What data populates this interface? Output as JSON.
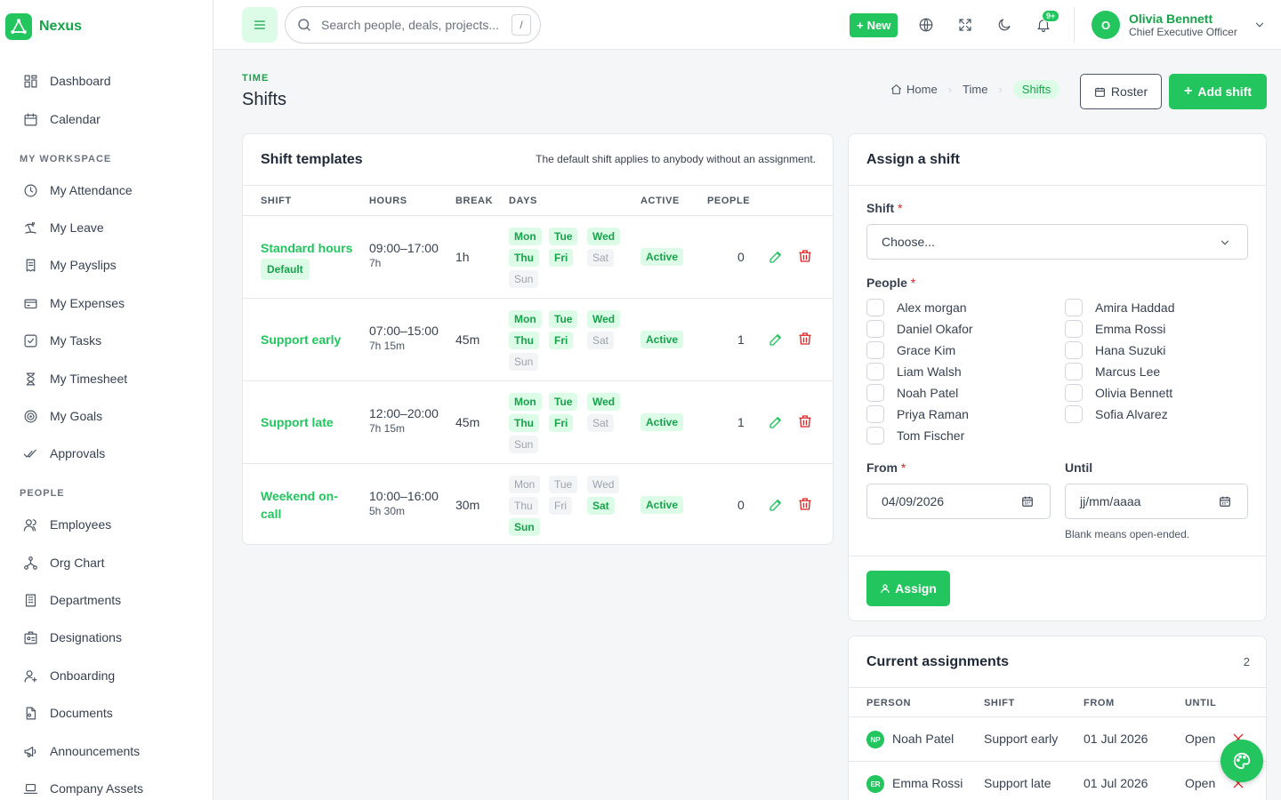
{
  "app": {
    "name": "Nexus"
  },
  "sidebar": {
    "top_items": [
      {
        "label": "Dashboard",
        "icon": "dashboard-icon"
      },
      {
        "label": "Calendar",
        "icon": "calendar-icon"
      }
    ],
    "workspace_title": "MY WORKSPACE",
    "workspace_items": [
      {
        "label": "My Attendance",
        "icon": "clock-icon"
      },
      {
        "label": "My Leave",
        "icon": "beach-icon"
      },
      {
        "label": "My Payslips",
        "icon": "receipt-icon"
      },
      {
        "label": "My Expenses",
        "icon": "credit-card-icon"
      },
      {
        "label": "My Tasks",
        "icon": "checkbox-icon"
      },
      {
        "label": "My Timesheet",
        "icon": "hourglass-icon"
      },
      {
        "label": "My Goals",
        "icon": "target-icon"
      },
      {
        "label": "Approvals",
        "icon": "double-check-icon"
      }
    ],
    "people_title": "PEOPLE",
    "people_items": [
      {
        "label": "Employees",
        "icon": "users-icon"
      },
      {
        "label": "Org Chart",
        "icon": "org-chart-icon"
      },
      {
        "label": "Departments",
        "icon": "building-icon"
      },
      {
        "label": "Designations",
        "icon": "id-card-icon"
      },
      {
        "label": "Onboarding",
        "icon": "user-plus-icon"
      },
      {
        "label": "Documents",
        "icon": "document-icon"
      },
      {
        "label": "Announcements",
        "icon": "megaphone-icon"
      },
      {
        "label": "Company Assets",
        "icon": "laptop-icon"
      }
    ]
  },
  "topbar": {
    "search_placeholder": "Search people, deals, projects...",
    "search_shortcut": "/",
    "new_label": "New",
    "notifications_badge": "9+",
    "user": {
      "initial": "O",
      "name": "Olivia Bennett",
      "role": "Chief Executive Officer"
    }
  },
  "page": {
    "eyebrow": "TIME",
    "title": "Shifts",
    "breadcrumb": [
      "Home",
      "Time",
      "Shifts"
    ],
    "roster_label": "Roster",
    "add_shift_label": "Add shift"
  },
  "templates": {
    "title": "Shift templates",
    "note": "The default shift applies to anybody without an assignment.",
    "columns": [
      "SHIFT",
      "HOURS",
      "BREAK",
      "DAYS",
      "ACTIVE",
      "PEOPLE"
    ],
    "day_labels": [
      "Mon",
      "Tue",
      "Wed",
      "Thu",
      "Fri",
      "Sat",
      "Sun"
    ],
    "rows": [
      {
        "name": "Standard hours",
        "default_label": "Default",
        "hours": "09:00–17:00",
        "duration": "7h",
        "break": "1h",
        "days_on": [
          true,
          true,
          true,
          true,
          true,
          false,
          false
        ],
        "status": "Active",
        "people": "0"
      },
      {
        "name": "Support early",
        "hours": "07:00–15:00",
        "duration": "7h 15m",
        "break": "45m",
        "days_on": [
          true,
          true,
          true,
          true,
          true,
          false,
          false
        ],
        "status": "Active",
        "people": "1"
      },
      {
        "name": "Support late",
        "hours": "12:00–20:00",
        "duration": "7h 15m",
        "break": "45m",
        "days_on": [
          true,
          true,
          true,
          true,
          true,
          false,
          false
        ],
        "status": "Active",
        "people": "1"
      },
      {
        "name": "Weekend on-call",
        "hours": "10:00–16:00",
        "duration": "5h 30m",
        "break": "30m",
        "days_on": [
          false,
          false,
          false,
          false,
          false,
          true,
          true
        ],
        "status": "Active",
        "people": "0"
      }
    ]
  },
  "assign": {
    "title": "Assign a shift",
    "shift_label": "Shift",
    "shift_placeholder": "Choose...",
    "people_label": "People",
    "people_left": [
      "Alex morgan",
      "Daniel Okafor",
      "Grace Kim",
      "Liam Walsh",
      "Noah Patel",
      "Priya Raman",
      "Tom Fischer"
    ],
    "people_right": [
      "Amira Haddad",
      "Emma Rossi",
      "Hana Suzuki",
      "Marcus Lee",
      "Olivia Bennett",
      "Sofia Alvarez"
    ],
    "from_label": "From",
    "from_value": "04/09/2026",
    "until_label": "Until",
    "until_placeholder": "jj/mm/aaaa",
    "until_hint": "Blank means open-ended.",
    "assign_label": "Assign",
    "required_mark": "*"
  },
  "assignments": {
    "title": "Current assignments",
    "count": "2",
    "columns": [
      "PERSON",
      "SHIFT",
      "FROM",
      "UNTIL"
    ],
    "rows": [
      {
        "initials": "NP",
        "person": "Noah Patel",
        "shift": "Support early",
        "from": "01 Jul 2026",
        "until": "Open"
      },
      {
        "initials": "ER",
        "person": "Emma Rossi",
        "shift": "Support late",
        "from": "01 Jul 2026",
        "until": "Open"
      }
    ]
  },
  "colors": {
    "accent": "#22c55e",
    "accent_dark": "#16a34a",
    "accent_light": "#dcfce7",
    "danger": "#dc2626"
  }
}
